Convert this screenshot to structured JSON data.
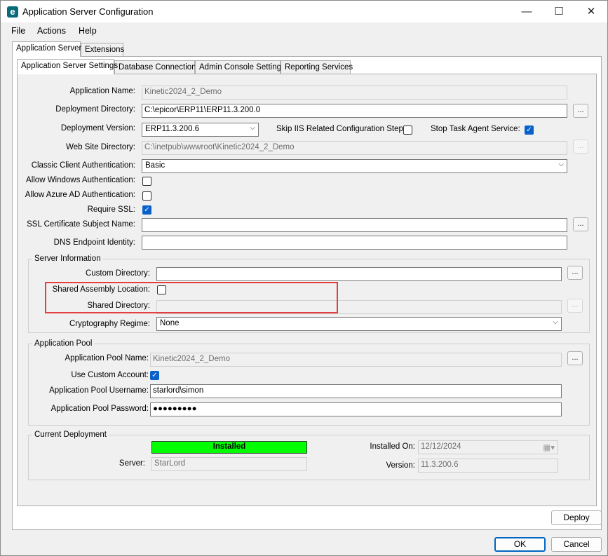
{
  "window": {
    "title": "Application Server Configuration",
    "app_icon": "e",
    "controls": {
      "minimize": "—",
      "maximize": "☐",
      "close": "✕"
    }
  },
  "menu": [
    "File",
    "Actions",
    "Help"
  ],
  "outer_tabs": [
    "Application Server",
    "Extensions"
  ],
  "inner_tabs": [
    "Application Server Settings",
    "Database Connection",
    "Admin Console Settings",
    "Reporting Services"
  ],
  "settings": {
    "app_name_label": "Application Name:",
    "app_name": "Kinetic2024_2_Demo",
    "deploy_dir_label": "Deployment Directory:",
    "deploy_dir": "C:\\epicor\\ERP11\\ERP11.3.200.0",
    "deploy_ver_label": "Deployment Version:",
    "deploy_ver": "ERP11.3.200.6",
    "skip_iis_label": "Skip IIS Related Configuration Steps:",
    "skip_iis": false,
    "stop_task_label": "Stop Task Agent Service:",
    "stop_task": true,
    "website_dir_label": "Web Site Directory:",
    "website_dir": "C:\\inetpub\\wwwroot\\Kinetic2024_2_Demo",
    "classic_auth_label": "Classic Client Authentication:",
    "classic_auth": "Basic",
    "allow_windows_label": "Allow Windows Authentication:",
    "allow_windows": false,
    "allow_azure_label": "Allow Azure AD Authentication:",
    "allow_azure": false,
    "require_ssl_label": "Require SSL:",
    "require_ssl": true,
    "ssl_subject_label": "SSL Certificate Subject Name:",
    "ssl_subject": "",
    "dns_label": "DNS Endpoint Identity:",
    "dns": ""
  },
  "server_info": {
    "title": "Server Information",
    "custom_dir_label": "Custom Directory:",
    "custom_dir": "",
    "shared_asm_label": "Shared Assembly Location:",
    "shared_asm": false,
    "shared_dir_label": "Shared Directory:",
    "shared_dir": "",
    "crypto_label": "Cryptography Regime:",
    "crypto": "None"
  },
  "app_pool": {
    "title": "Application Pool",
    "name_label": "Application Pool Name:",
    "name": "Kinetic2024_2_Demo",
    "custom_acct_label": "Use Custom Account:",
    "custom_acct": true,
    "user_label": "Application Pool Username:",
    "user": "starlord\\simon",
    "pass_label": "Application Pool Password:",
    "pass": "●●●●●●●●●"
  },
  "current_deployment": {
    "title": "Current Deployment",
    "status": "Installed",
    "status_color": "#00ff00",
    "server_label": "Server:",
    "server": "StarLord",
    "installed_on_label": "Installed On:",
    "installed_on": "12/12/2024",
    "version_label": "Version:",
    "version": "11.3.200.6"
  },
  "buttons": {
    "browse": "...",
    "deploy": "Deploy",
    "ok": "OK",
    "cancel": "Cancel"
  },
  "check_mark": "✓",
  "chevron": "⌵",
  "calendar_icon": "▦▾"
}
